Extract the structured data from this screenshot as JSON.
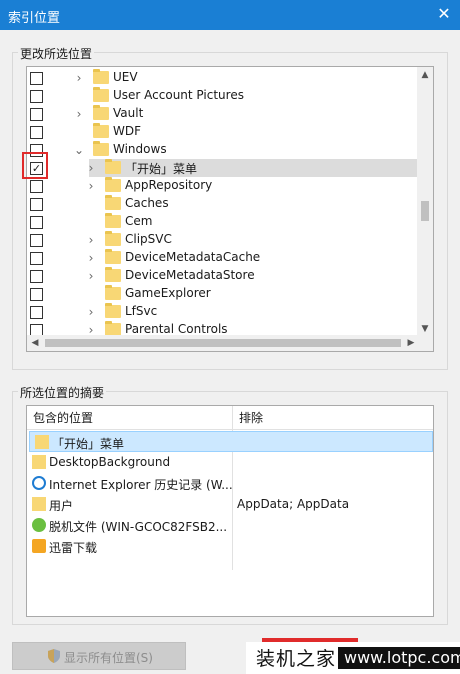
{
  "window": {
    "title": "索引位置",
    "close_glyph": "✕"
  },
  "change_group": {
    "label": "更改所选位置"
  },
  "tree": {
    "rows": [
      {
        "label": "UEV",
        "checked": false,
        "expander": "›",
        "level": 1
      },
      {
        "label": "User Account Pictures",
        "checked": false,
        "expander": "",
        "level": 1
      },
      {
        "label": "Vault",
        "checked": false,
        "expander": "›",
        "level": 1
      },
      {
        "label": "WDF",
        "checked": false,
        "expander": "",
        "level": 1
      },
      {
        "label": "Windows",
        "checked": false,
        "expander": "⌄",
        "level": 1
      },
      {
        "label": "「开始」菜单",
        "checked": true,
        "expander": "›",
        "level": 2,
        "selected": true
      },
      {
        "label": "AppRepository",
        "checked": false,
        "expander": "›",
        "level": 2
      },
      {
        "label": "Caches",
        "checked": false,
        "expander": "",
        "level": 2
      },
      {
        "label": "Cem",
        "checked": false,
        "expander": "",
        "level": 2
      },
      {
        "label": "ClipSVC",
        "checked": false,
        "expander": "›",
        "level": 2
      },
      {
        "label": "DeviceMetadataCache",
        "checked": false,
        "expander": "›",
        "level": 2
      },
      {
        "label": "DeviceMetadataStore",
        "checked": false,
        "expander": "›",
        "level": 2
      },
      {
        "label": "GameExplorer",
        "checked": false,
        "expander": "",
        "level": 2
      },
      {
        "label": "LfSvc",
        "checked": false,
        "expander": "›",
        "level": 2
      },
      {
        "label": "Parental Controls",
        "checked": false,
        "expander": "›",
        "level": 2
      }
    ]
  },
  "summary_group": {
    "label": "所选位置的摘要"
  },
  "summary": {
    "col_included": "包含的位置",
    "col_excluded": "排除",
    "rows": [
      {
        "icon": "folder-icon",
        "name": "「开始」菜单",
        "excluded": "",
        "selected": true
      },
      {
        "icon": "folder-icon",
        "name": "DesktopBackground",
        "excluded": ""
      },
      {
        "icon": "internet-explorer-icon",
        "name": "Internet Explorer 历史记录 (W...",
        "excluded": ""
      },
      {
        "icon": "folder-icon",
        "name": "用户",
        "excluded": "AppData; AppData"
      },
      {
        "icon": "offline-files-icon",
        "name": "脱机文件 (WIN-GCOC82FSB2...",
        "excluded": ""
      },
      {
        "icon": "xunlei-icon",
        "name": "迅雷下载",
        "excluded": ""
      }
    ]
  },
  "buttons": {
    "show_all": "显示所有位置(S)"
  },
  "watermark": {
    "brand": "装机之家",
    "url": "www.lotpc.com"
  }
}
